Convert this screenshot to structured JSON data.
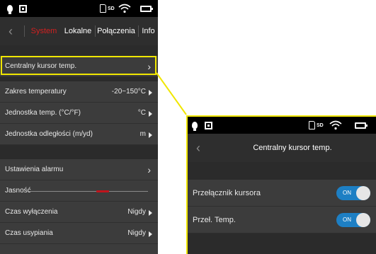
{
  "statusbar": {
    "sd_label": "SD"
  },
  "main_screen": {
    "tabs": [
      {
        "label": "System",
        "active": true
      },
      {
        "label": "Lokalne",
        "active": false
      },
      {
        "label": "Połączenia",
        "active": false
      },
      {
        "label": "Info",
        "active": false
      }
    ],
    "rows": {
      "center_cursor": {
        "label": "Centralny kursor temp."
      },
      "temp_range": {
        "label": "Zakres temperatury",
        "value": "-20~150°C"
      },
      "temp_unit": {
        "label": "Jednostka temp. (°C/°F)",
        "value": "°C"
      },
      "distance_unit": {
        "label": "Jednostka odległości (m/yd)",
        "value": "m"
      },
      "alarm_settings": {
        "label": "Ustawienia alarmu"
      },
      "brightness": {
        "label": "Jasność",
        "level": 0.62
      },
      "shutdown_time": {
        "label": "Czas wyłączenia",
        "value": "Nigdy"
      },
      "sleep_time": {
        "label": "Czas usypiania",
        "value": "Nigdy"
      }
    }
  },
  "detail_screen": {
    "title": "Centralny kursor temp.",
    "rows": [
      {
        "label": "Przełącznik kursora",
        "toggle": "ON"
      },
      {
        "label": "Przeł. Temp.",
        "toggle": "ON"
      }
    ]
  },
  "colors": {
    "active_tab": "#d32020",
    "highlight": "#f0e600",
    "toggle_on": "#1d7fc4",
    "slider": "#c0141c"
  }
}
